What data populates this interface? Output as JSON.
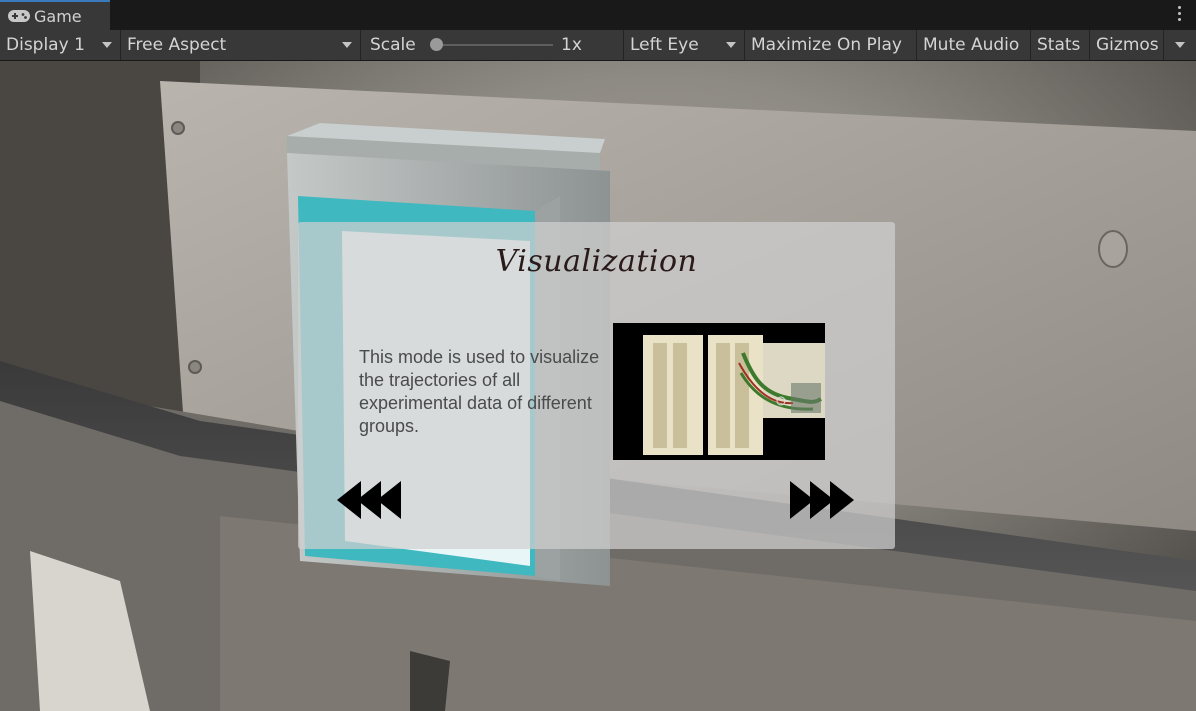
{
  "window": {
    "tab_label": "Game",
    "tab_icon": "gamepad-icon",
    "menu_icon": "kebab-menu-icon"
  },
  "toolbar": {
    "display": "Display 1",
    "aspect": "Free Aspect",
    "scale_label": "Scale",
    "scale_value": "1x",
    "scale_level": 0,
    "eye": "Left Eye",
    "maximize": "Maximize On Play",
    "mute": "Mute Audio",
    "stats": "Stats",
    "gizmos": "Gizmos"
  },
  "panel": {
    "title": "Visualization",
    "description": "This mode is used to visualize the trajectories of all experimental data of different groups.",
    "prev_icon": "rewind-icon",
    "next_icon": "fast-forward-icon"
  },
  "colors": {
    "accent": "#3a79bb",
    "toolbar_bg": "#383838",
    "panel_bg": "#d0d0d0",
    "exit_sign": "#3fb8c0"
  }
}
